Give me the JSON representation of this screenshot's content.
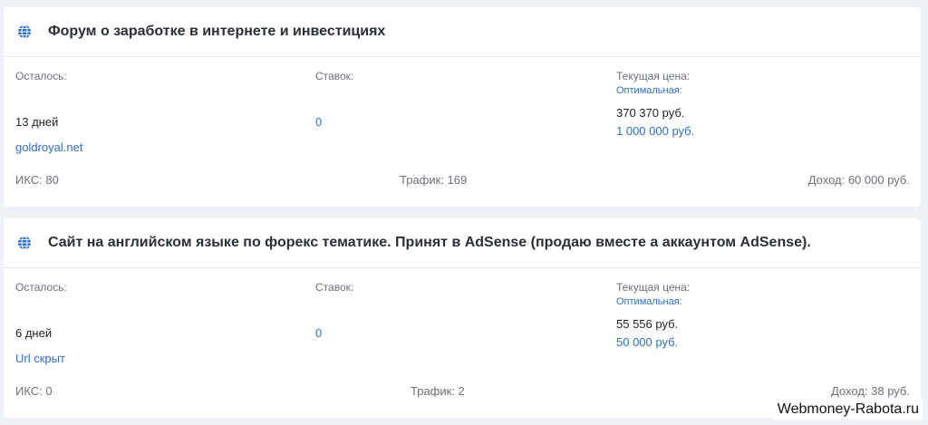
{
  "listings": [
    {
      "title": "Форум о заработке в интернете и инвестициях",
      "remaining_label": "Осталось:",
      "remaining_value": "13 дней",
      "bids_label": "Ставок:",
      "bids_value": "0",
      "price_label": "Текущая цена:",
      "optimal_label": "Оптимальная:",
      "price_value": "370 370 руб.",
      "optimal_value": "1 000 000 руб.",
      "site": "goldroyal.net",
      "iks": "ИКС: 80",
      "traffic": "Трафик: 169",
      "income": "Доход: 60 000 руб."
    },
    {
      "title": "Сайт на английском языке по форекс тематике. Принят в AdSense (продаю вместе а аккаунтом AdSense).",
      "remaining_label": "Осталось:",
      "remaining_value": "6 дней",
      "bids_label": "Ставок:",
      "bids_value": "0",
      "price_label": "Текущая цена:",
      "optimal_label": "Оптимальная:",
      "price_value": "55 556 руб.",
      "optimal_value": "50 000 руб.",
      "site": "Url скрыт",
      "iks": "ИКС: 0",
      "traffic": "Трафик: 2",
      "income": "Доход: 38 руб."
    }
  ],
  "watermark": "Webmoney-Rabota.ru",
  "colors": {
    "link": "#2f6fc7",
    "background": "#eef1f6",
    "card": "#ffffff"
  },
  "icons": {
    "header_icon": "globe-icon"
  }
}
